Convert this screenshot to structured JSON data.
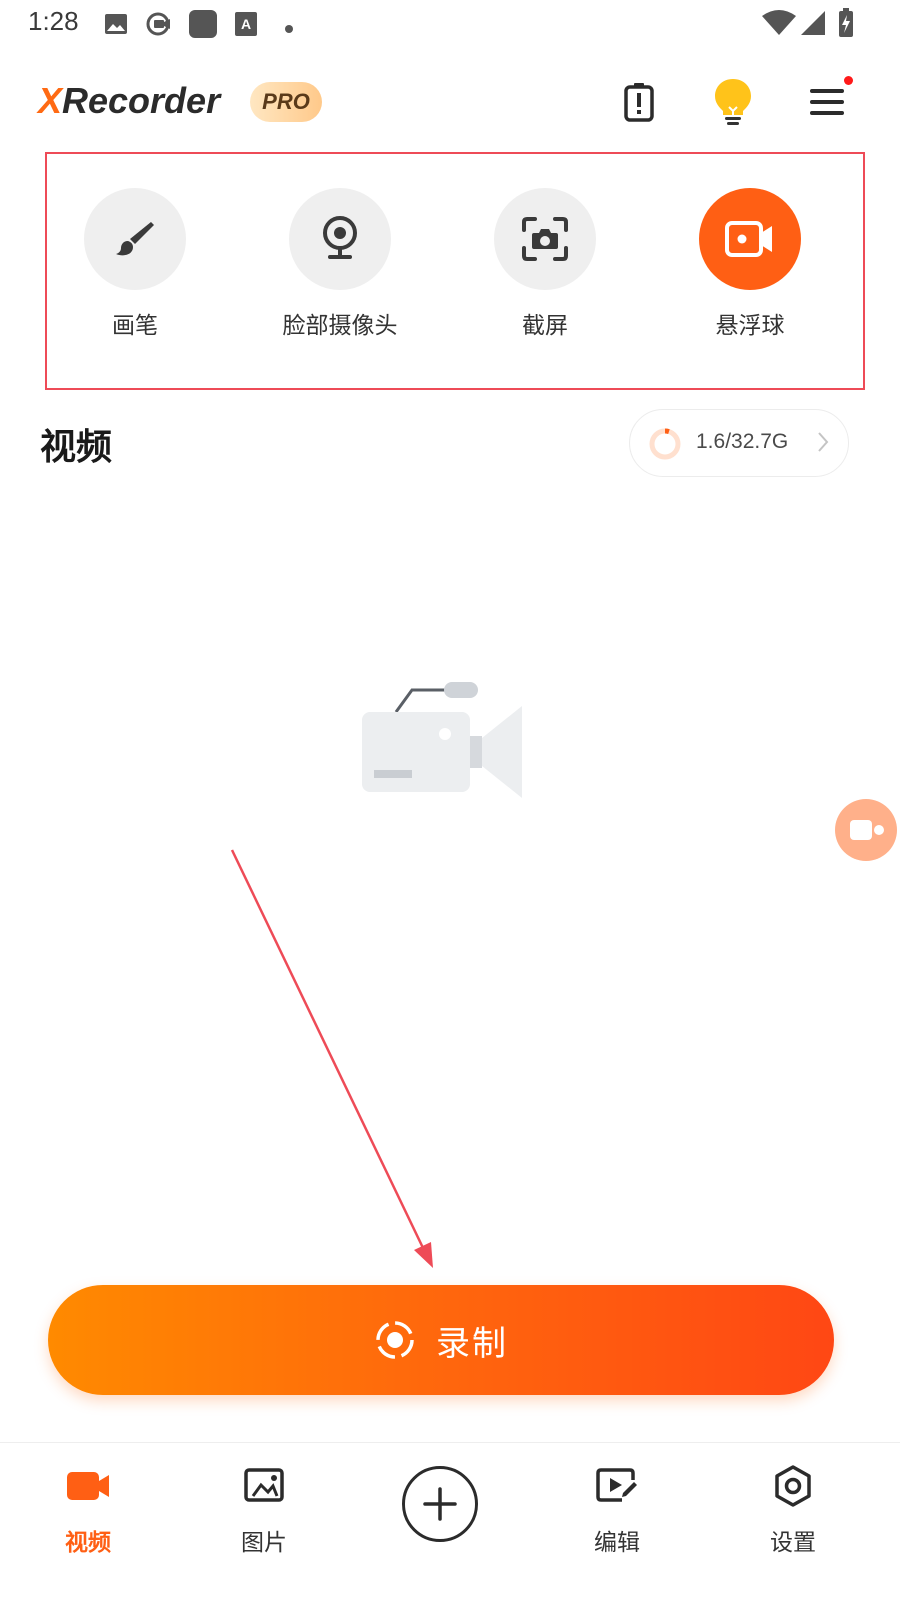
{
  "status_bar": {
    "time": "1:28",
    "icons": [
      "gallery-icon",
      "screen-record-icon",
      "app-square-icon",
      "font-a-icon",
      "dot-icon",
      "wifi-icon",
      "signal-icon",
      "battery-charging-icon"
    ]
  },
  "header": {
    "brand_x": "X",
    "brand_rest": "Recorder",
    "badge": "PRO",
    "icons": [
      "battery-alert-icon",
      "lightbulb-icon",
      "hamburger-menu-icon"
    ]
  },
  "tools": [
    {
      "label": "画笔",
      "icon": "brush-icon",
      "active": false
    },
    {
      "label": "脸部摄像头",
      "icon": "webcam-icon",
      "active": false
    },
    {
      "label": "截屏",
      "icon": "screenshot-icon",
      "active": false
    },
    {
      "label": "悬浮球",
      "icon": "floating-ball-icon",
      "active": true
    }
  ],
  "section": {
    "title": "视频",
    "storage_used": "1.6/32.7G",
    "storage_fraction": 0.049
  },
  "empty_state": {
    "icon": "video-camera-empty-icon"
  },
  "record_button": {
    "label": "录制",
    "icon": "record-icon"
  },
  "bottom_nav": {
    "items": [
      {
        "label": "视频",
        "icon": "video-icon",
        "active": true
      },
      {
        "label": "图片",
        "icon": "image-cast-icon",
        "active": false
      },
      {
        "label": "",
        "icon": "add-icon",
        "active": false
      },
      {
        "label": "编辑",
        "icon": "edit-video-icon",
        "active": false
      },
      {
        "label": "设置",
        "icon": "settings-icon",
        "active": false
      }
    ]
  },
  "colors": {
    "accent": "#ff5f14",
    "highlight_border": "#ee4b57",
    "tool_bg": "#efefef",
    "record_gradient_start": "#ff8a00",
    "record_gradient_end": "#ff4714"
  }
}
